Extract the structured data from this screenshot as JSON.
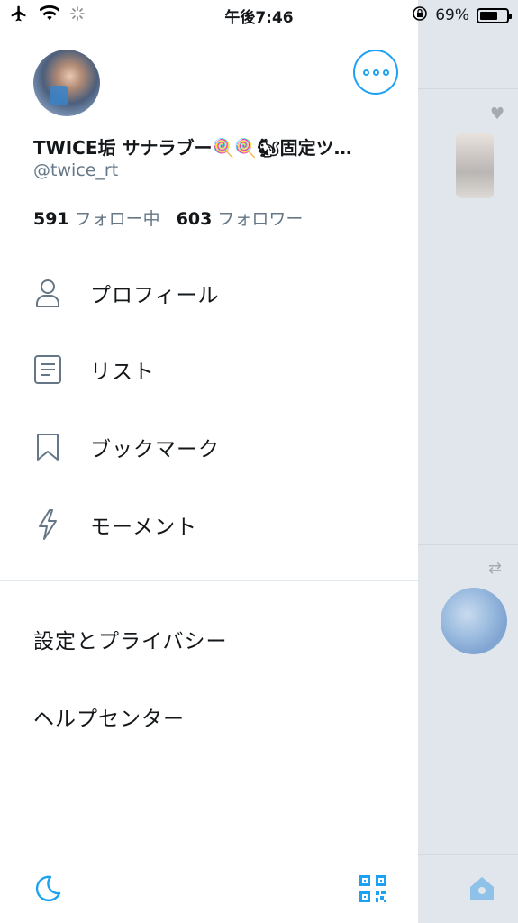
{
  "status_bar": {
    "time": "午後7:46",
    "battery_percent": "69%",
    "battery_level": 0.69,
    "icons": [
      "airplane-icon",
      "wifi-icon",
      "activity-spinner-icon",
      "rotation-lock-icon",
      "battery-icon"
    ]
  },
  "profile": {
    "display_name": "TWICE垢 サナラブー🍭🍭🐿固定ツ…",
    "handle": "@twice_rt",
    "following_count": "591",
    "following_label": "フォロー中",
    "followers_count": "603",
    "followers_label": "フォロワー"
  },
  "menu": {
    "items": [
      {
        "label": "プロフィール",
        "icon": "person-icon"
      },
      {
        "label": "リスト",
        "icon": "list-icon"
      },
      {
        "label": "ブックマーク",
        "icon": "bookmark-icon"
      },
      {
        "label": "モーメント",
        "icon": "lightning-icon"
      }
    ],
    "settings_label": "設定とプライバシー",
    "help_label": "ヘルプセンター"
  },
  "bottom": {
    "night_mode_icon": "moon-icon",
    "qr_icon": "qr-code-icon"
  },
  "colors": {
    "accent": "#1da1f2",
    "text_primary": "#14171a",
    "text_secondary": "#657786",
    "dim_background": "#e1e6ed"
  }
}
